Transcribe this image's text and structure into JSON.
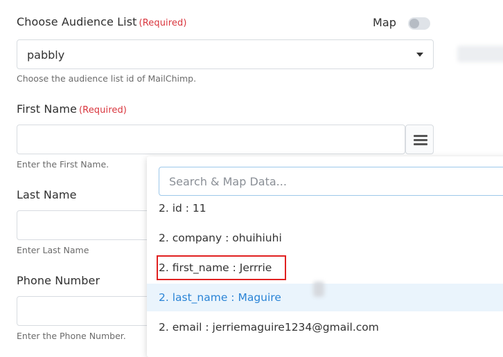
{
  "audience": {
    "label": "Choose Audience List",
    "required": "(Required)",
    "map_label": "Map",
    "selected": "pabbly",
    "help": "Choose the audience list id of MailChimp."
  },
  "first_name": {
    "label": "First Name",
    "required": "(Required)",
    "value": "",
    "help": "Enter the First Name."
  },
  "last_name": {
    "label": "Last Name",
    "help": "Enter Last Name"
  },
  "phone": {
    "label": "Phone Number",
    "help": "Enter the Phone Number."
  },
  "map_dropdown": {
    "search_placeholder": "Search & Map Data...",
    "options": [
      "2. id : 11",
      "2. company : ohuihiuhi",
      "2. first_name : Jerrrie",
      "2. last_name : Maguire",
      "2. email : jerriemaguire1234@gmail.com"
    ],
    "highlighted_index": 3,
    "boxed_index": 2
  },
  "icons": {
    "menu": "hamburger-menu-icon",
    "caret": "chevron-down-icon"
  },
  "colors": {
    "required": "#d9363e",
    "highlight_text": "#2a84d6",
    "highlight_bg": "#eaf4fc",
    "annotation_box": "#e02020"
  }
}
